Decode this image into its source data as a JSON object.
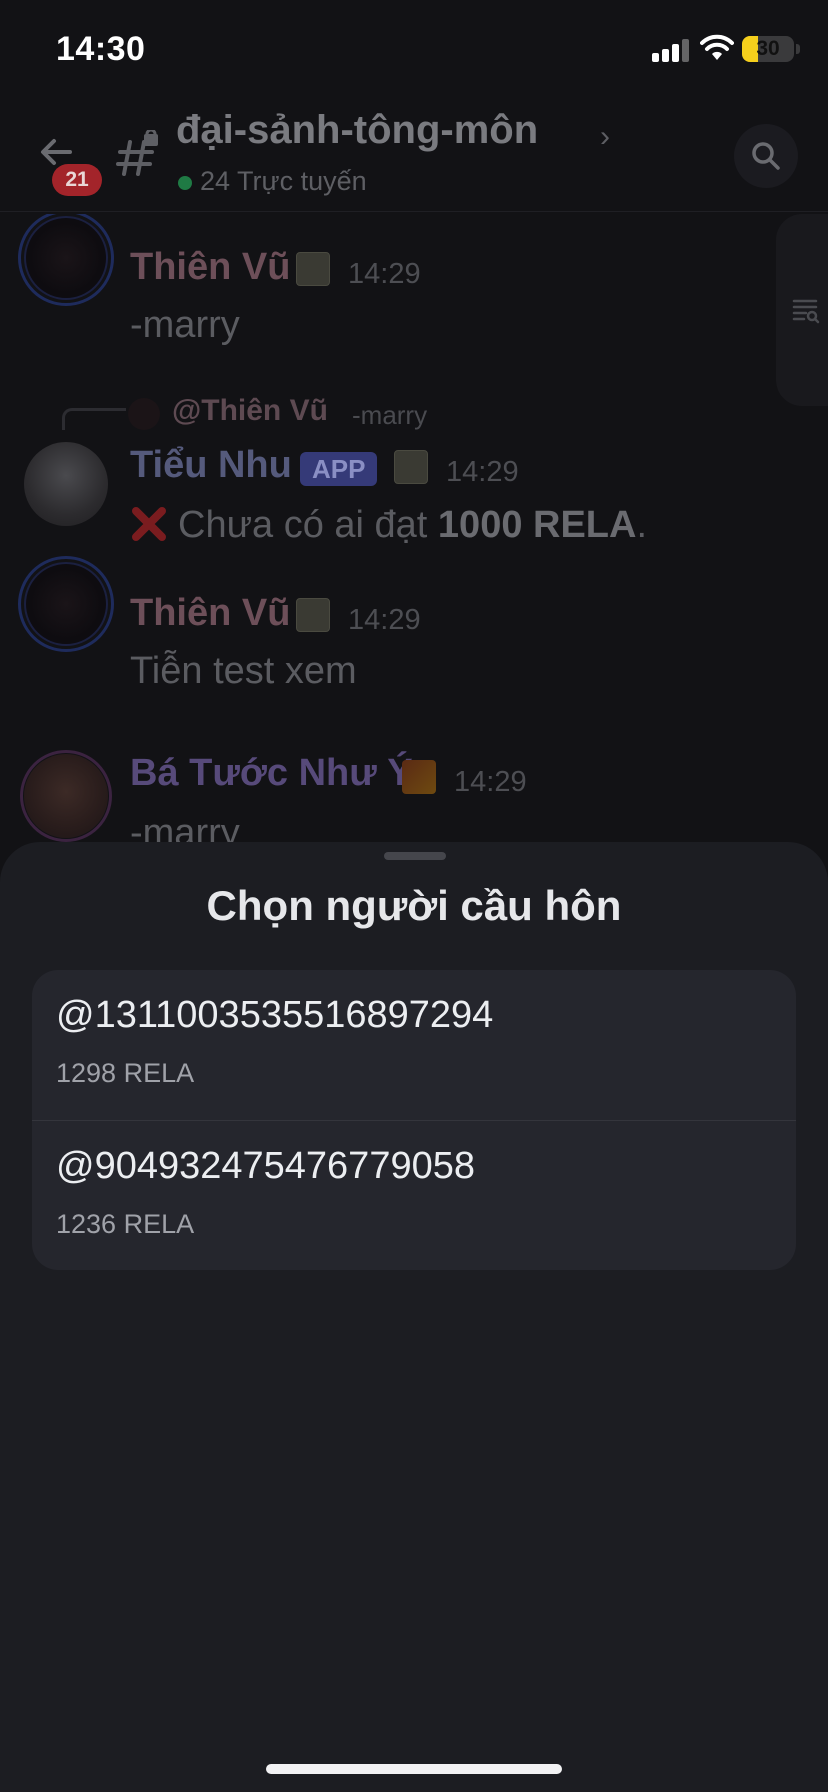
{
  "status_bar": {
    "time": "14:30",
    "battery_level": "30",
    "battery_fraction": 0.3
  },
  "header": {
    "back_icon": "arrow-left-icon",
    "unread_count": "21",
    "channel_icon": "hash-lock-icon",
    "channel_name": "đại-sảnh-tông-môn",
    "online_text": "24 Trực tuyến",
    "online_color": "#23a55a",
    "search_icon": "search-icon"
  },
  "side_panel": {
    "icon": "threads-icon"
  },
  "messages": [
    {
      "author": "Thiên Vũ",
      "time": "14:29",
      "text": "-marry"
    },
    {
      "reply": {
        "author": "@Thiên Vũ",
        "text": "-marry"
      },
      "author": "Tiểu Nhu",
      "tag": "APP",
      "time": "14:29",
      "text_prefix": "Chưa có ai đạt ",
      "text_bold": "1000 RELA",
      "text_suffix": "."
    },
    {
      "author": "Thiên Vũ",
      "time": "14:29",
      "text": "Tiễn test xem"
    },
    {
      "author": "Bá Tước Như Ý",
      "time": "14:29",
      "text": "-marry"
    }
  ],
  "sheet": {
    "title": "Chọn người cầu hôn",
    "options": [
      {
        "name": "@1311003535516897294",
        "amount": "1298 RELA"
      },
      {
        "name": "@904932475476779058",
        "amount": "1236 RELA"
      }
    ]
  },
  "colors": {
    "sheet_bg": "#1c1d22",
    "option_bg": "#25262d",
    "app_tag": "#5865f2",
    "battery": "#f5cf1c"
  }
}
